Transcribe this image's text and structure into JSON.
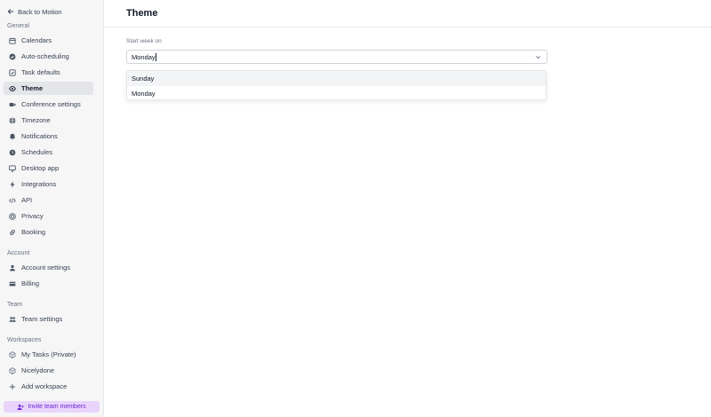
{
  "back_label": "Back to Motion",
  "sidebar": {
    "groups": [
      {
        "label": "General",
        "items": [
          {
            "label": "Calendars",
            "icon": "calendar-icon"
          },
          {
            "label": "Auto-scheduling",
            "icon": "check-circle-icon"
          },
          {
            "label": "Task defaults",
            "icon": "checklist-icon"
          },
          {
            "label": "Theme",
            "icon": "eye-icon",
            "active": true
          },
          {
            "label": "Conference settings",
            "icon": "video-icon"
          },
          {
            "label": "Timezone",
            "icon": "globe-icon"
          },
          {
            "label": "Notifications",
            "icon": "bell-icon"
          },
          {
            "label": "Schedules",
            "icon": "clock-icon"
          },
          {
            "label": "Desktop app",
            "icon": "monitor-icon"
          },
          {
            "label": "Integrations",
            "icon": "bolt-icon"
          },
          {
            "label": "API",
            "icon": "code-icon"
          },
          {
            "label": "Privacy",
            "icon": "privacy-icon"
          },
          {
            "label": "Booking",
            "icon": "link-icon"
          }
        ]
      },
      {
        "label": "Account",
        "items": [
          {
            "label": "Account settings",
            "icon": "user-icon"
          },
          {
            "label": "Billing",
            "icon": "credit-card-icon"
          }
        ]
      },
      {
        "label": "Team",
        "items": [
          {
            "label": "Team settings",
            "icon": "users-icon"
          }
        ]
      },
      {
        "label": "Workspaces",
        "items": [
          {
            "label": "My Tasks (Private)",
            "icon": "workspace-icon"
          },
          {
            "label": "Nicelydone",
            "icon": "workspace-icon"
          },
          {
            "label": "Add workspace",
            "icon": "plus-icon"
          }
        ]
      }
    ]
  },
  "invite_label": "Invite team members",
  "page_title": "Theme",
  "start_week": {
    "label": "Start week on",
    "value": "Monday",
    "options": [
      "Sunday",
      "Monday"
    ],
    "highlighted": "Sunday"
  }
}
